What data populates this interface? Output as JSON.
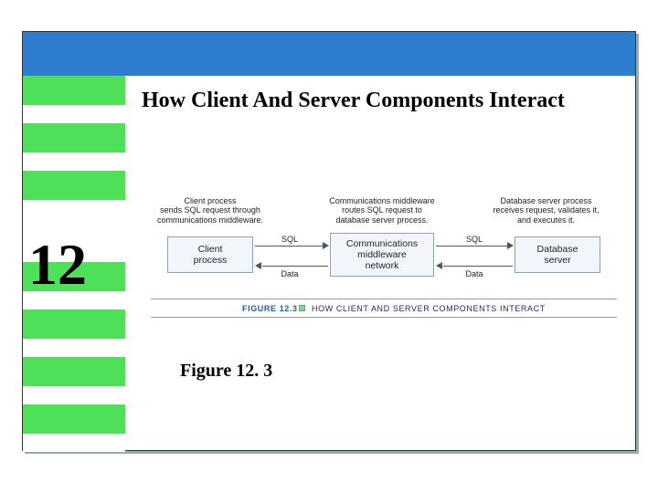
{
  "slide": {
    "chapter_number": "12",
    "title": "How Client And Server Components Interact",
    "figure_caption": "Figure 12. 3"
  },
  "diagram": {
    "columns": [
      {
        "header": "Client process\nsends SQL request through\ncommunications middleware.",
        "box": "Client\nprocess"
      },
      {
        "header": "Communications middleware\nroutes SQL request to\ndatabase server process.",
        "box": "Communications\nmiddleware\nnetwork"
      },
      {
        "header": "Database server process\nreceives request, validates it,\nand executes it.",
        "box": "Database\nserver"
      }
    ],
    "arrows": {
      "top_left": "SQL",
      "top_right": "SQL",
      "bottom_left": "Data",
      "bottom_right": "Data"
    },
    "figure_ref": "FIGURE 12.3",
    "figure_title": "How Client and Server Components Interact"
  }
}
